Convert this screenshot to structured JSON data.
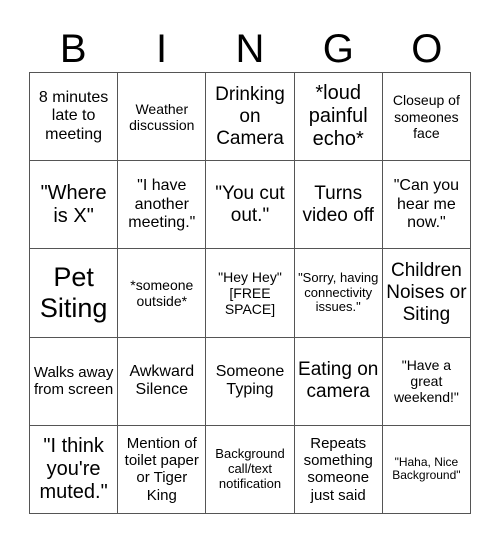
{
  "header": {
    "letters": [
      "B",
      "I",
      "N",
      "G",
      "O"
    ]
  },
  "cells": [
    "8 minutes late to meeting",
    "Weather discussion",
    "Drinking on Camera",
    "*loud painful echo*",
    "Closeup of someones face",
    "\"Where is X\"",
    "\"I have another meeting.\"",
    "\"You cut out.\"",
    "Turns video off",
    "\"Can you hear me now.\"",
    "Pet Siting",
    "*someone outside*",
    "\"Hey Hey\" [FREE SPACE]",
    "\"Sorry, having connectivity issues.\"",
    "Children Noises or Siting",
    "Walks away from screen",
    "Awkward Silence",
    "Someone Typing",
    "Eating on camera",
    "\"Have a great weekend!\"",
    "\"I think you're muted.\"",
    "Mention of toilet paper or Tiger King",
    "Background call/text notification",
    "Repeats something someone just said",
    "\"Haha, Nice Background\""
  ]
}
